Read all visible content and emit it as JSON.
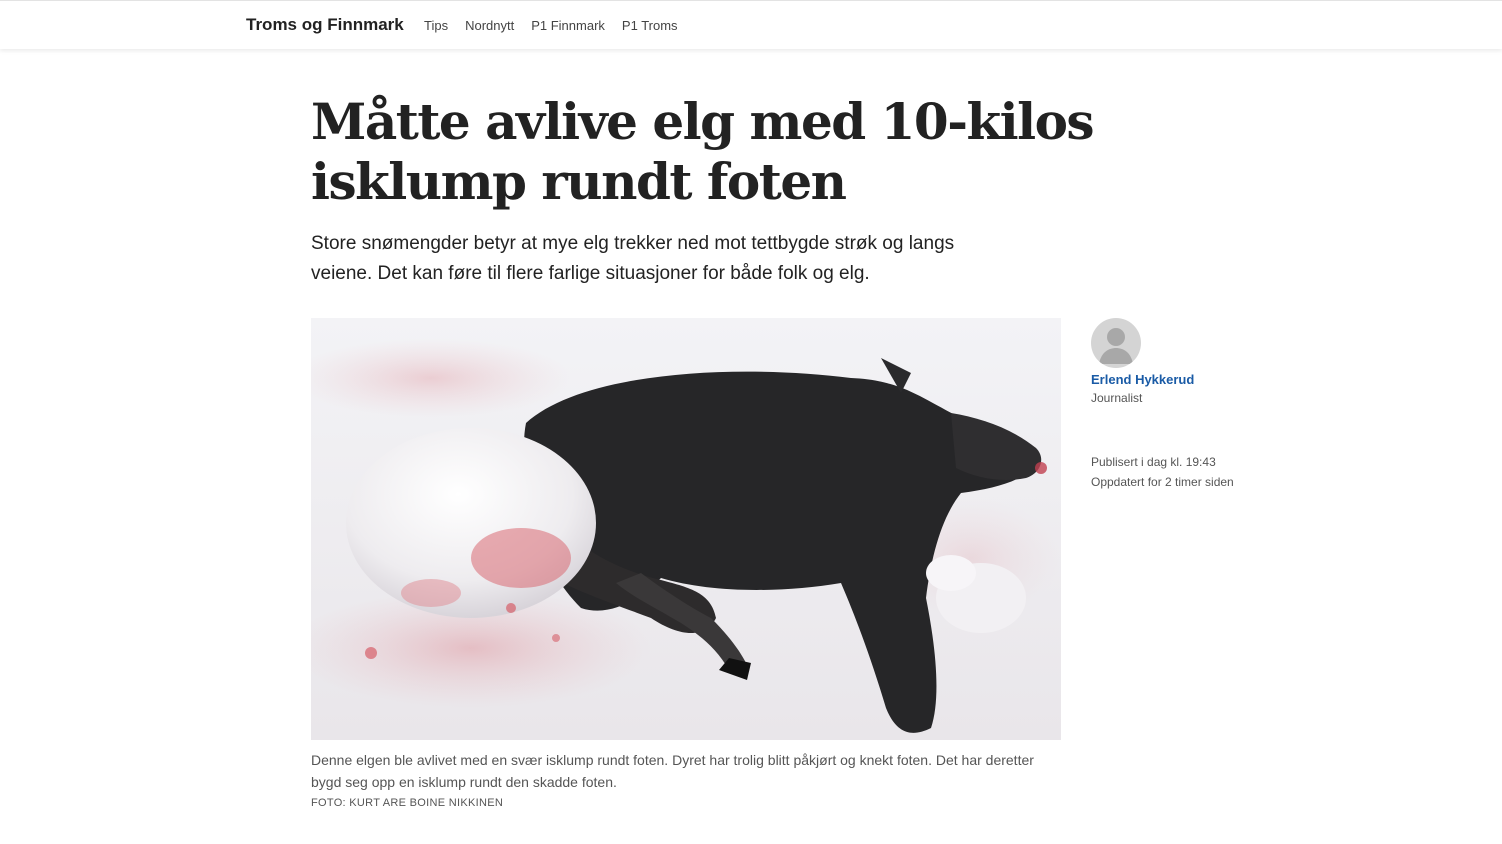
{
  "header": {
    "brand": "Troms og Finnmark",
    "nav": [
      "Tips",
      "Nordnytt",
      "P1 Finnmark",
      "P1 Troms"
    ]
  },
  "article": {
    "title": "Måtte avlive elg med 10-kilos isklump rundt foten",
    "lead": "Store snømengder betyr at mye elg trekker ned mot tettbygde strøk og langs veiene. Det kan føre til flere farlige situasjoner for både folk og elg.",
    "image": {
      "caption": "Denne elgen ble avlivet med en svær isklump rundt foten. Dyret har trolig blitt påkjørt og knekt foten. Det har deretter bygd seg opp en isklump rundt den skadde foten.",
      "credit": "FOTO: KURT ARE BOINE NIKKINEN"
    }
  },
  "byline": {
    "name": "Erlend Hykkerud",
    "role": "Journalist",
    "published": "Publisert i dag kl. 19:43",
    "updated": "Oppdatert for 2 timer siden",
    "avatar_icon": "user-silhouette-icon"
  },
  "colors": {
    "author_link": "#1a5ba6",
    "text": "#222222",
    "muted": "#555555"
  }
}
